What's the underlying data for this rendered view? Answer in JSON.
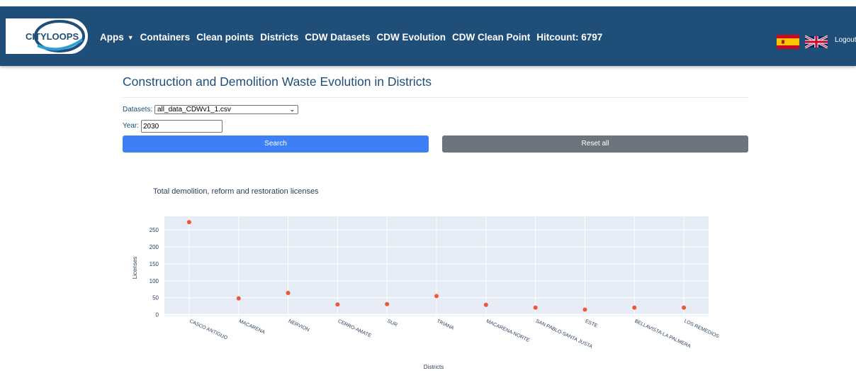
{
  "nav": {
    "logo_text": "CITYLOOPS",
    "items": [
      "Apps",
      "Containers",
      "Clean points",
      "Districts",
      "CDW Datasets",
      "CDW Evolution",
      "CDW Clean Point",
      "Hitcount: 6797"
    ],
    "logout": "Logout"
  },
  "page": {
    "title": "Construction and Demolition Waste Evolution in Districts",
    "datasets_label": "Datasets:",
    "datasets_value": "all_data_CDWv1_1.csv",
    "year_label": "Year:",
    "year_value": "2030",
    "search_button": "Search",
    "reset_button": "Reset all"
  },
  "colors": {
    "navbar": "#1f4e79",
    "search_button": "#3d7ff5",
    "reset_button": "#6c757d",
    "plot_bg": "#e5ecf6",
    "marker": "#ef553b"
  },
  "chart_data": {
    "type": "scatter",
    "title": "Total demolition, reform and restoration licenses",
    "xlabel": "Districts",
    "ylabel": "Licenses",
    "ylim": [
      -5,
      290
    ],
    "yticks": [
      0,
      50,
      100,
      150,
      200,
      250
    ],
    "grid": true,
    "categories": [
      "CASCO ANTIGUO",
      "MACARENA",
      "NERVION",
      "CERRO-AMATE",
      "SUR",
      "TRIANA",
      "MACARENA-NORTE",
      "SAN PABLO-SANTA JUSTA",
      "ESTE",
      "BELLAVISTA-LA PALMERA",
      "LOS REMEDIOS"
    ],
    "values": [
      273,
      48,
      64,
      30,
      31,
      55,
      29,
      21,
      15,
      21,
      21
    ]
  }
}
